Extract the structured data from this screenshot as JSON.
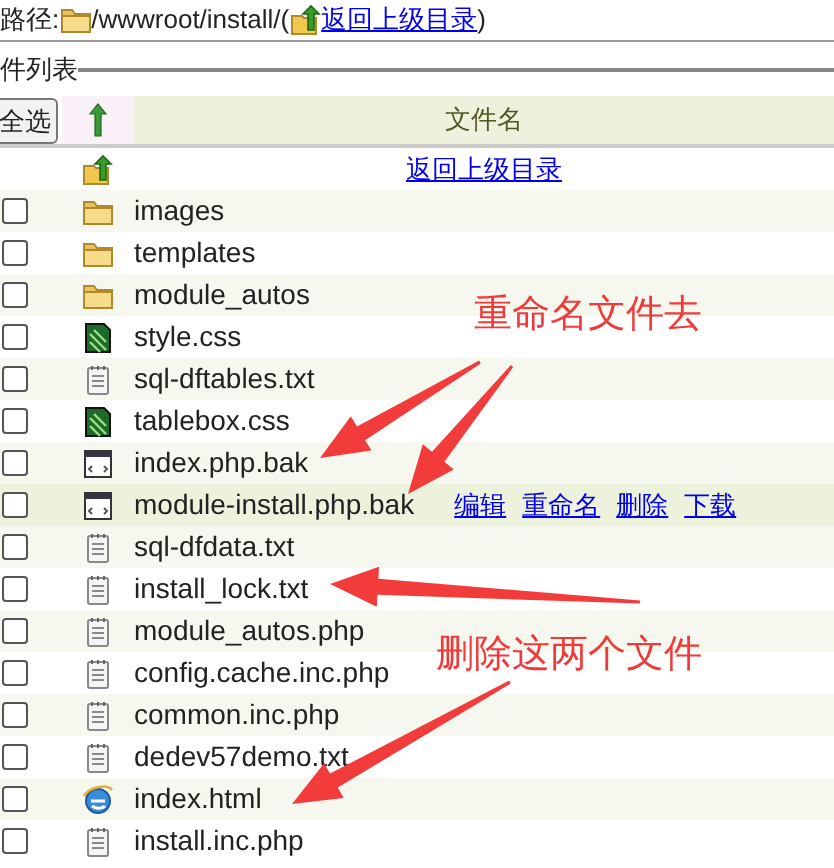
{
  "path": {
    "label": "路径:",
    "value": "/wwwroot/install/(",
    "link": "返回上级目录",
    "close": ")"
  },
  "section_title": "件列表",
  "table": {
    "select_all": "全选",
    "column_name": "文件名",
    "parent_link": "返回上级目录",
    "rows": [
      {
        "name": "images",
        "kind": "folder",
        "checked": false,
        "hovered": false
      },
      {
        "name": "templates",
        "kind": "folder",
        "checked": false,
        "hovered": false
      },
      {
        "name": "module_autos",
        "kind": "folder",
        "checked": false,
        "hovered": false
      },
      {
        "name": "style.css",
        "kind": "css",
        "checked": false,
        "hovered": false
      },
      {
        "name": "sql-dftables.txt",
        "kind": "text",
        "checked": false,
        "hovered": false
      },
      {
        "name": "tablebox.css",
        "kind": "css",
        "checked": false,
        "hovered": false
      },
      {
        "name": "index.php.bak",
        "kind": "window",
        "checked": false,
        "hovered": false
      },
      {
        "name": "module-install.php.bak",
        "kind": "window",
        "checked": false,
        "hovered": true,
        "actions": [
          "编辑",
          "重命名",
          "删除",
          "下载"
        ]
      },
      {
        "name": "sql-dfdata.txt",
        "kind": "text",
        "checked": false,
        "hovered": false
      },
      {
        "name": "install_lock.txt",
        "kind": "text",
        "checked": false,
        "hovered": false
      },
      {
        "name": "module_autos.php",
        "kind": "text",
        "checked": false,
        "hovered": false
      },
      {
        "name": "config.cache.inc.php",
        "kind": "text",
        "checked": false,
        "hovered": false
      },
      {
        "name": "common.inc.php",
        "kind": "text",
        "checked": false,
        "hovered": false
      },
      {
        "name": "dedev57demo.txt",
        "kind": "text",
        "checked": false,
        "hovered": false
      },
      {
        "name": "index.html",
        "kind": "web",
        "checked": false,
        "hovered": false
      },
      {
        "name": "install.inc.php",
        "kind": "text",
        "checked": false,
        "hovered": false
      }
    ]
  },
  "annotations": [
    {
      "text": "重命名文件去"
    },
    {
      "text": "删除这两个文件"
    }
  ]
}
